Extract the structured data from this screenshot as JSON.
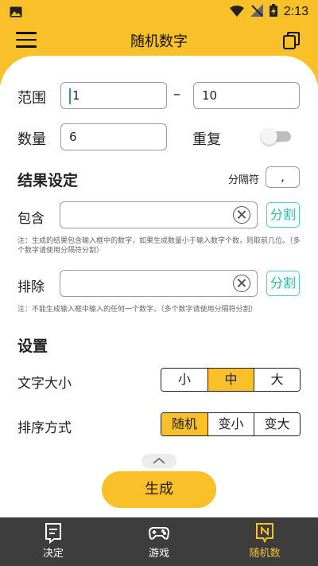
{
  "status": {
    "time": "2:13"
  },
  "appbar": {
    "title": "随机数字"
  },
  "range": {
    "label": "范围",
    "min_value": "1",
    "separator": "–",
    "max_value": "10"
  },
  "count": {
    "label": "数量",
    "value": "6"
  },
  "repeat": {
    "label": "重复",
    "enabled": false
  },
  "result_settings": {
    "title": "结果设定",
    "delimiter_label": "分隔符",
    "delimiter_value": ","
  },
  "include": {
    "label": "包含",
    "value": "",
    "split_label": "分割",
    "note": "注：生成的结果包含输入框中的数字，如果生成数量小于输入数字个数，则取前几位。（多个数字请使用分隔符分割）"
  },
  "exclude": {
    "label": "排除",
    "value": "",
    "split_label": "分割",
    "note": "注：不能生成输入框中输入的任何一个数字。（多个数字请使用分隔符分割）"
  },
  "settings": {
    "title": "设置",
    "font_size": {
      "label": "文字大小",
      "options": [
        "小",
        "中",
        "大"
      ],
      "selected": "中"
    },
    "sort": {
      "label": "排序方式",
      "options": [
        "随机",
        "变小",
        "变大"
      ],
      "selected": "随机"
    }
  },
  "generate_label": "生成",
  "bottom_nav": [
    {
      "label": "决定",
      "icon": "decide-icon",
      "active": false
    },
    {
      "label": "游戏",
      "icon": "gamepad-icon",
      "active": false
    },
    {
      "label": "随机数",
      "icon": "random-number-icon",
      "active": true
    }
  ],
  "colors": {
    "accent": "#f9c02a",
    "teal": "#4ecdc4",
    "nav_bg": "#3d3d3d"
  }
}
